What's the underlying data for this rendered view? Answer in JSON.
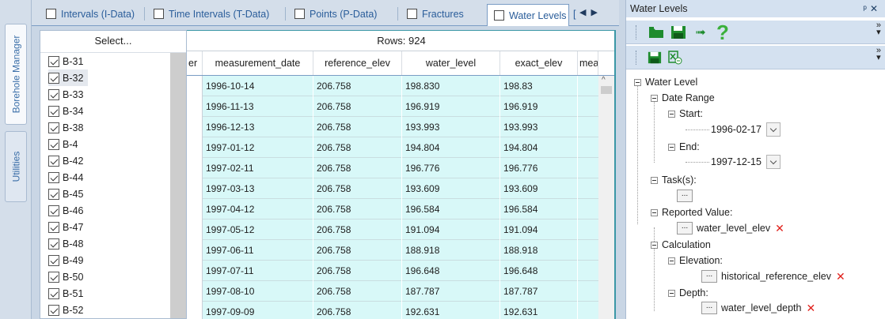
{
  "vertical_tabs": [
    {
      "label": "Borehole Manager",
      "active": true
    },
    {
      "label": "Utilities",
      "active": false
    }
  ],
  "top_tabs": [
    {
      "label": "Intervals (I-Data)",
      "active": false
    },
    {
      "label": "Time Intervals (T-Data)",
      "active": false
    },
    {
      "label": "Points (P-Data)",
      "active": false
    },
    {
      "label": "Fractures",
      "active": false
    },
    {
      "label": "Water Levels",
      "active": true
    },
    {
      "label": "[",
      "active": false
    }
  ],
  "nav_arrows": {
    "left": "◀",
    "right": "▶"
  },
  "select_list": {
    "header": "Select...",
    "items": [
      {
        "label": "B-31",
        "checked": true,
        "selected": false
      },
      {
        "label": "B-32",
        "checked": true,
        "selected": true
      },
      {
        "label": "B-33",
        "checked": true,
        "selected": false
      },
      {
        "label": "B-34",
        "checked": true,
        "selected": false
      },
      {
        "label": "B-38",
        "checked": true,
        "selected": false
      },
      {
        "label": "B-4",
        "checked": true,
        "selected": false
      },
      {
        "label": "B-42",
        "checked": true,
        "selected": false
      },
      {
        "label": "B-44",
        "checked": true,
        "selected": false
      },
      {
        "label": "B-45",
        "checked": true,
        "selected": false
      },
      {
        "label": "B-46",
        "checked": true,
        "selected": false
      },
      {
        "label": "B-47",
        "checked": true,
        "selected": false
      },
      {
        "label": "B-48",
        "checked": true,
        "selected": false
      },
      {
        "label": "B-49",
        "checked": true,
        "selected": false
      },
      {
        "label": "B-50",
        "checked": true,
        "selected": false
      },
      {
        "label": "B-51",
        "checked": true,
        "selected": false
      },
      {
        "label": "B-52",
        "checked": true,
        "selected": false
      }
    ]
  },
  "grid": {
    "rows_label": "Rows: 924",
    "columns": [
      "er",
      "measurement_date",
      "reference_elev",
      "water_level",
      "exact_elev",
      "mea"
    ],
    "rows": [
      [
        "1996-10-14",
        "206.758",
        "198.830",
        "198.83"
      ],
      [
        "1996-11-13",
        "206.758",
        "196.919",
        "196.919"
      ],
      [
        "1996-12-13",
        "206.758",
        "193.993",
        "193.993"
      ],
      [
        "1997-01-12",
        "206.758",
        "194.804",
        "194.804"
      ],
      [
        "1997-02-11",
        "206.758",
        "196.776",
        "196.776"
      ],
      [
        "1997-03-13",
        "206.758",
        "193.609",
        "193.609"
      ],
      [
        "1997-04-12",
        "206.758",
        "196.584",
        "196.584"
      ],
      [
        "1997-05-12",
        "206.758",
        "191.094",
        "191.094"
      ],
      [
        "1997-06-11",
        "206.758",
        "188.918",
        "188.918"
      ],
      [
        "1997-07-11",
        "206.758",
        "196.648",
        "196.648"
      ],
      [
        "1997-08-10",
        "206.758",
        "187.787",
        "187.787"
      ],
      [
        "1997-09-09",
        "206.758",
        "192.631",
        "192.631"
      ]
    ]
  },
  "dock": {
    "title": "Water Levels",
    "title_controls": "ᵖ ✕",
    "toolbar1": {
      "icons": [
        "open-folder-icon",
        "save-icon",
        "arrow-forward-icon",
        "help-icon"
      ],
      "help_glyph": "?",
      "arrow_glyph": "➟"
    },
    "toolbar2": {
      "icons": [
        "save-icon",
        "excel-export-icon"
      ]
    },
    "overflow_glyph": "»",
    "tree": {
      "root": "Water Level",
      "date_range": "Date Range",
      "start_label": "Start:",
      "start_value": "1996-02-17",
      "end_label": "End:",
      "end_value": "1997-12-15",
      "tasks_label": "Task(s):",
      "reported_value_label": "Reported Value:",
      "reported_value": "water_level_elev",
      "calculation_label": "Calculation",
      "elevation_label": "Elevation:",
      "elevation_value": "historical_reference_elev",
      "depth_label": "Depth:",
      "depth_value": "water_level_depth",
      "ellipsis": "...",
      "remove_glyph": "✕"
    }
  },
  "colors": {
    "row_highlight": "#d8f8f8",
    "accent_green": "#1e8c2e",
    "remove_red": "#e0201b",
    "help_green": "#3bb03b"
  }
}
